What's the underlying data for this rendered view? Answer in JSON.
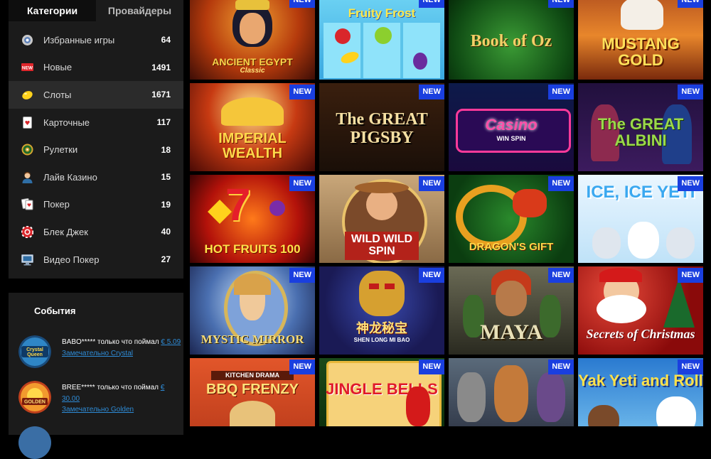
{
  "sidebar": {
    "tabs": [
      {
        "label": "Категории"
      },
      {
        "label": "Провайдеры"
      }
    ],
    "categories": [
      {
        "label": "Избранные игры",
        "count": "64",
        "icon": "favorites-icon"
      },
      {
        "label": "Новые",
        "count": "1491",
        "icon": "new-icon"
      },
      {
        "label": "Слоты",
        "count": "1671",
        "icon": "lemon-icon"
      },
      {
        "label": "Карточные",
        "count": "117",
        "icon": "cards-icon"
      },
      {
        "label": "Рулетки",
        "count": "18",
        "icon": "roulette-icon"
      },
      {
        "label": "Лайв Казино",
        "count": "15",
        "icon": "live-dealer-icon"
      },
      {
        "label": "Покер",
        "count": "19",
        "icon": "poker-icon"
      },
      {
        "label": "Блек Джек",
        "count": "40",
        "icon": "blackjack-icon"
      },
      {
        "label": "Видео Покер",
        "count": "27",
        "icon": "video-poker-icon"
      }
    ]
  },
  "events": {
    "title": "События",
    "items": [
      {
        "user": "BABO*****",
        "action": "только что поймал",
        "amount": "€ 5.09",
        "game": "Замечательно Crystal",
        "thumb_text": "Crystal Queen"
      },
      {
        "user": "BREE*****",
        "action": "только что поймал",
        "amount": "€ 30.00",
        "game": "Замечательно Golden",
        "thumb_text": "Golden"
      }
    ]
  },
  "badge_label": "NEW",
  "games": [
    {
      "title": "ANCIENT EGYPT",
      "sub": "Classic"
    },
    {
      "title": "Fruity Frost",
      "sub": ""
    },
    {
      "title": "Book of Oz",
      "sub": ""
    },
    {
      "title": "MUSTANG GOLD",
      "sub": ""
    },
    {
      "title": "IMPERIAL WEALTH",
      "sub": ""
    },
    {
      "title": "The GREAT PIGSBY",
      "sub": ""
    },
    {
      "title": "Casino",
      "sub": "WIN SPIN"
    },
    {
      "title": "The GREAT ALBINI",
      "sub": ""
    },
    {
      "title": "HOT FRUITS 100",
      "sub": ""
    },
    {
      "title": "WILD WILD SPIN",
      "sub": ""
    },
    {
      "title": "DRAGON'S GIFT",
      "sub": ""
    },
    {
      "title": "ICE, ICE YETI",
      "sub": ""
    },
    {
      "title": "MYSTIC MIRROR",
      "sub": ""
    },
    {
      "title": "神龙秘宝",
      "sub": "SHEN LONG MI BAO"
    },
    {
      "title": "MAYA",
      "sub": ""
    },
    {
      "title": "Secrets of Christmas",
      "sub": ""
    },
    {
      "title": "BBQ FRENZY",
      "sub": "KITCHEN DRAMA"
    },
    {
      "title": "JINGLE BELLS",
      "sub": ""
    },
    {
      "title": "",
      "sub": ""
    },
    {
      "title": "Yak Yeti and Roll",
      "sub": ""
    }
  ]
}
